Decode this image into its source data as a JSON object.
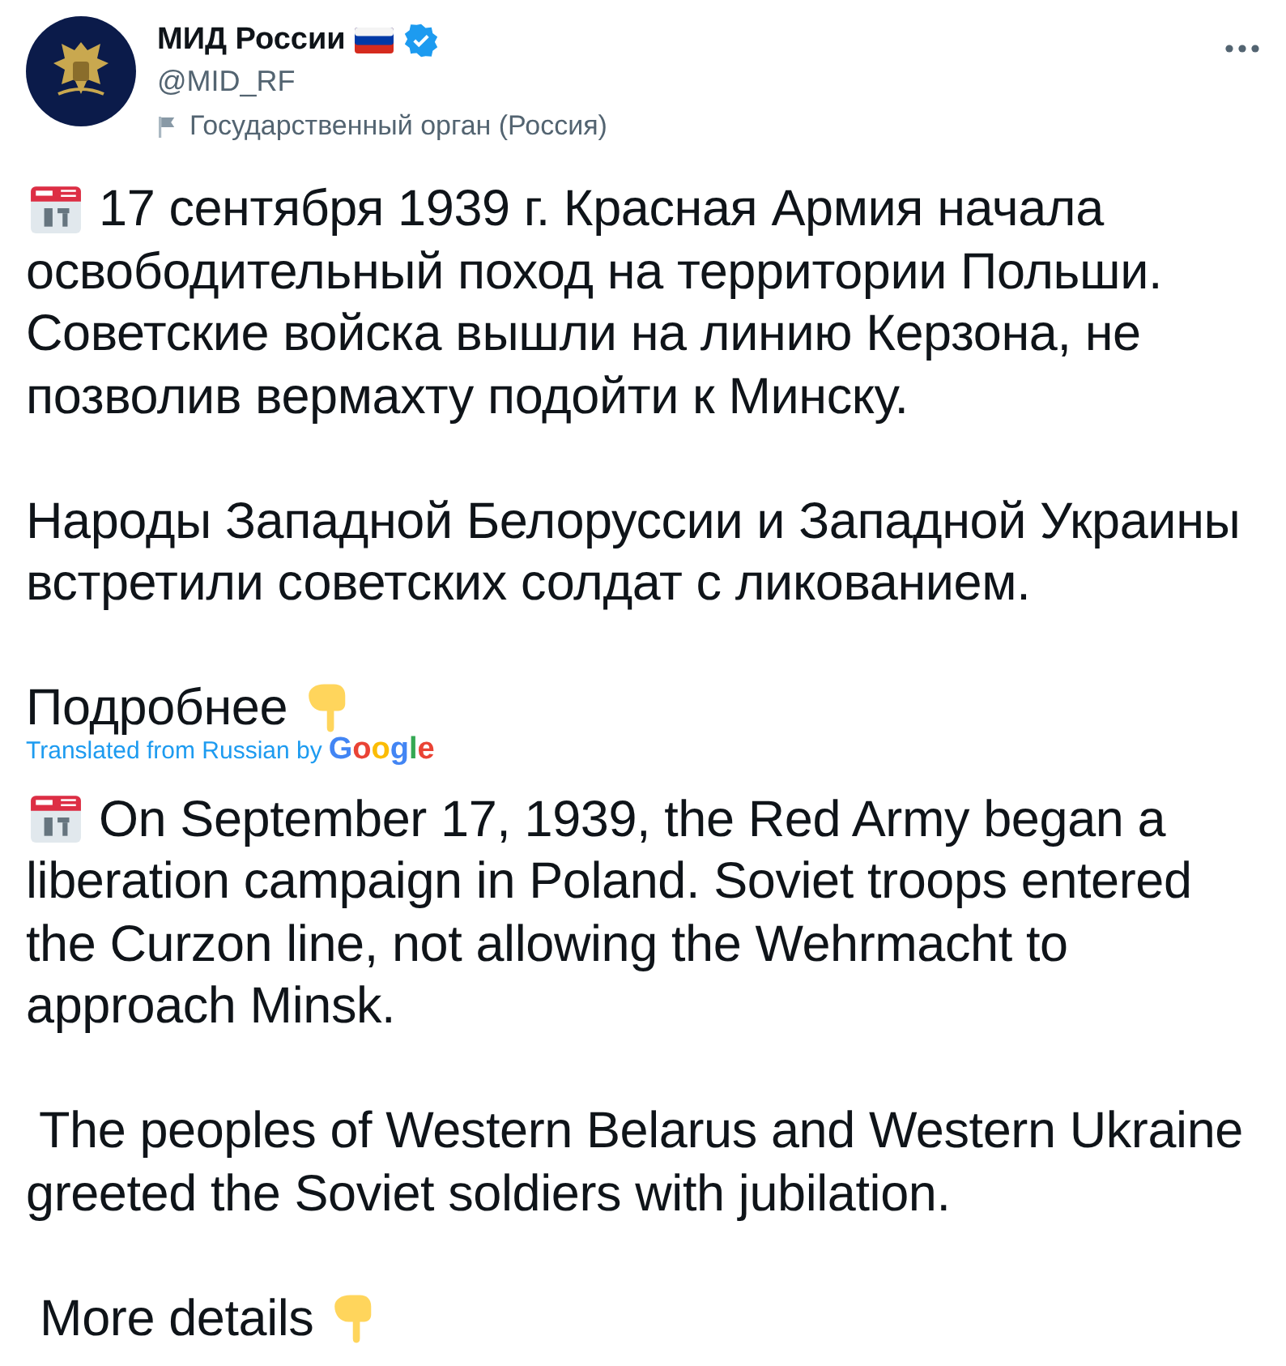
{
  "author": {
    "name": "МИД России",
    "handle": "@MID_RF",
    "verified": true,
    "label": "Государственный орган (Россия)"
  },
  "original": [
    {
      "kind": "dated",
      "lines": [
        "17 сентября 1939 г. Красная Армия начала",
        "освободительный поход на территории Польши.",
        "Советские войска вышли на линию Керзона, не",
        "позволив вермахту подойти к Минску."
      ]
    },
    {
      "kind": "plain",
      "lines": [
        "Народы Западной Белоруссии и Западной Украины",
        "встретили советских солдат с ликованием."
      ]
    },
    {
      "kind": "more",
      "lines": [
        "Подробнее"
      ]
    }
  ],
  "translation_note": {
    "text": "Translated from Russian by",
    "provider": "Google"
  },
  "translation": [
    {
      "kind": "dated",
      "lines": [
        "On September 17, 1939, the Red Army began a",
        "liberation campaign in Poland. Soviet troops entered",
        "the Curzon line, not allowing the Wehrmacht to",
        "approach Minsk."
      ]
    },
    {
      "kind": "plain",
      "lines": [
        " The peoples of Western Belarus and Western Ukraine",
        "greeted the Soviet soldiers with jubilation."
      ]
    },
    {
      "kind": "more",
      "lines": [
        " More details"
      ]
    }
  ]
}
